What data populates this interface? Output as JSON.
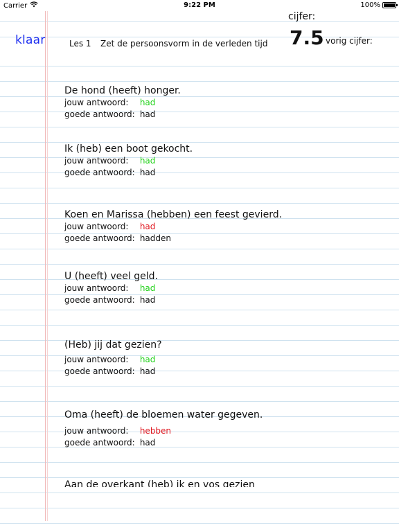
{
  "statusbar": {
    "carrier": "Carrier",
    "time": "9:22 PM",
    "battery": "100%"
  },
  "header": {
    "done_button": "klaar",
    "lesson": "Les 1",
    "instruction": "Zet de persoonsvorm in de verleden tijd",
    "grade_label": "cijfer:",
    "grade_value": "7.5",
    "previous_grade_label": "vorig cijfer:"
  },
  "labels": {
    "your_answer": "jouw antwoord:",
    "correct_answer": "goede antwoord:"
  },
  "colors": {
    "correct": "#22d21a",
    "wrong": "#e0161e",
    "accent": "#1d2ef0"
  },
  "questions": [
    {
      "text": "De hond (heeft) honger.",
      "your_answer": "had",
      "correct_answer": "had",
      "status": "correct"
    },
    {
      "text": "Ik (heb) een boot gekocht.",
      "your_answer": "had",
      "correct_answer": "had",
      "status": "correct"
    },
    {
      "text": "Koen en Marissa (hebben) een feest gevierd.",
      "your_answer": "had",
      "correct_answer": "hadden",
      "status": "wrong"
    },
    {
      "text": "U (heeft) veel geld.",
      "your_answer": "had",
      "correct_answer": "had",
      "status": "correct"
    },
    {
      "text": "(Heb) jij dat gezien?",
      "your_answer": "had",
      "correct_answer": "had",
      "status": "correct"
    },
    {
      "text": "Oma (heeft) de bloemen water gegeven.",
      "your_answer": "hebben",
      "correct_answer": "had",
      "status": "wrong"
    },
    {
      "text": "Aan de overkant (heb) ik en vos gezien",
      "your_answer": "",
      "correct_answer": "",
      "status": "neutral"
    }
  ]
}
